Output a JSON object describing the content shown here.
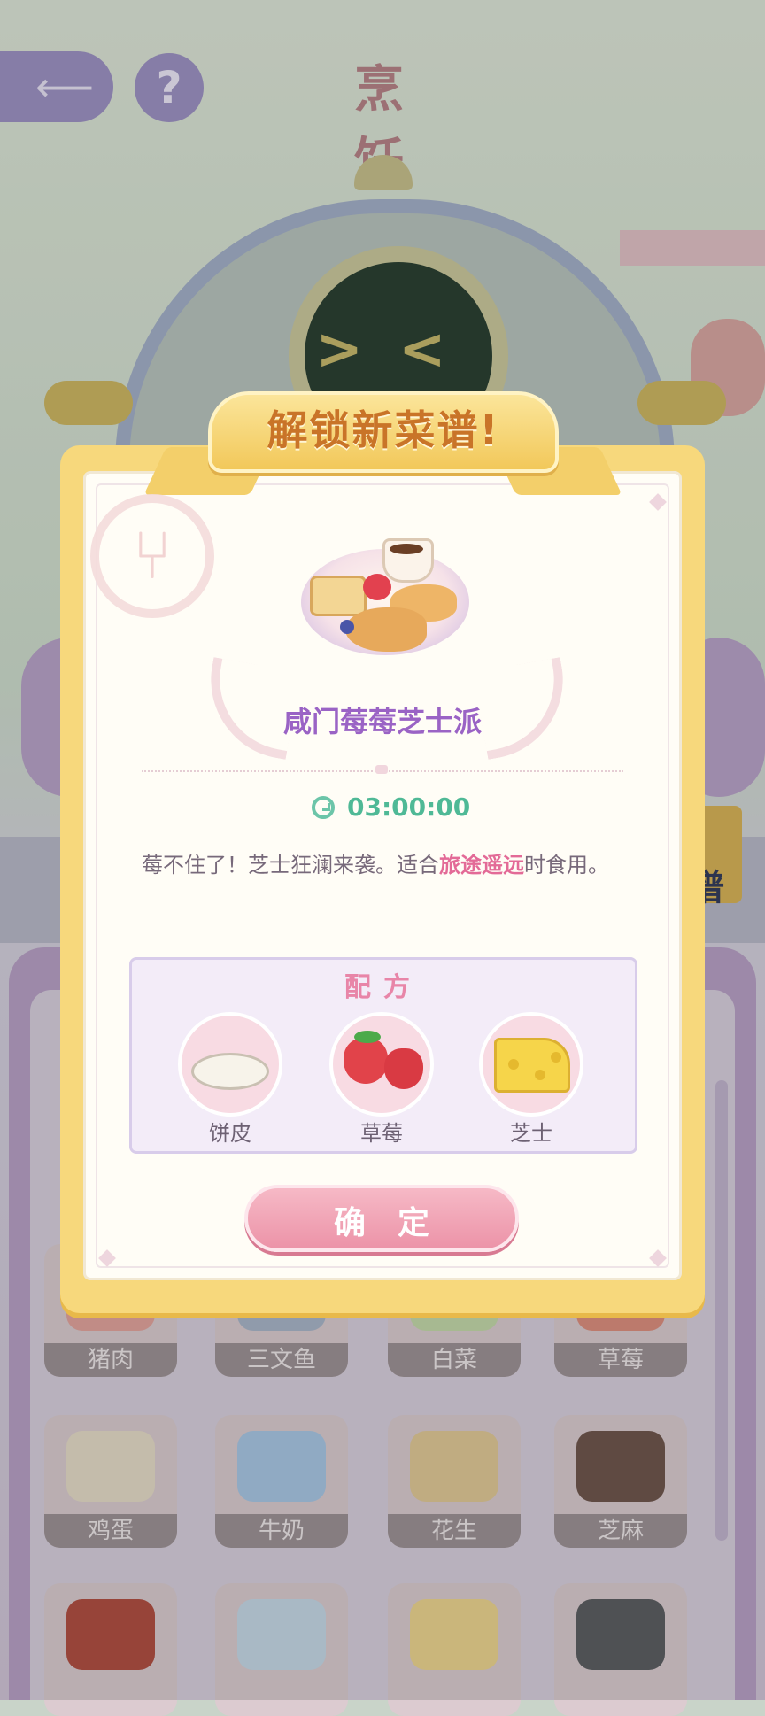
{
  "scene": {
    "title": "烹 饪",
    "help_label": "?",
    "back_glyph": "⟵",
    "robot_face": "><",
    "side_tab": "谱"
  },
  "ingredient_grid": [
    {
      "label": "猪肉",
      "color": "#e4a29b"
    },
    {
      "label": "三文鱼",
      "color": "#a9b4c9"
    },
    {
      "label": "白菜",
      "color": "#c5d8a9"
    },
    {
      "label": "草莓",
      "color": "#df8b7c"
    },
    {
      "label": "鸡蛋",
      "color": "#e8dcc8"
    },
    {
      "label": "牛奶",
      "color": "#a9c6e6"
    },
    {
      "label": "花生",
      "color": "#e3c995"
    },
    {
      "label": "芝麻",
      "color": "#6d5148"
    },
    {
      "label": "",
      "color": "#b14a3d"
    },
    {
      "label": "",
      "color": "#c7d8e8"
    },
    {
      "label": "",
      "color": "#efd58e"
    },
    {
      "label": "",
      "color": "#5a5a5e"
    }
  ],
  "dialog": {
    "banner": "解锁新菜谱!",
    "dish_name": "咸门莓莓芝士派",
    "timer": "03:00:00",
    "description_before": "莓不住了！芝士狂澜来袭。适合",
    "description_highlight": "旅途遥远",
    "description_after": "时食用。",
    "recipe_title": "配方",
    "ingredients": [
      {
        "name": "饼皮",
        "icon": "pie-crust-icon"
      },
      {
        "name": "草莓",
        "icon": "strawberry-icon"
      },
      {
        "name": "芝士",
        "icon": "cheese-icon"
      }
    ],
    "confirm_label": "确定"
  },
  "colors": {
    "frame": "#f7d87c",
    "dish_name": "#9a63c5",
    "timer": "#4fb996",
    "highlight": "#e36a97",
    "confirm": "#ec93a8"
  }
}
